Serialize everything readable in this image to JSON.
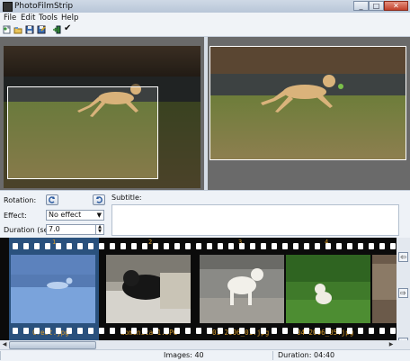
{
  "window": {
    "title": "PhotoFilmStrip",
    "minimize": "_",
    "maximize": "□",
    "close": "✕"
  },
  "menu": [
    "File",
    "Edit",
    "Tools",
    "Help"
  ],
  "toolbar": {
    "icons": [
      "new-project-icon",
      "open-project-icon",
      "save-icon",
      "save-as-icon",
      "import-pictures-icon",
      "render-checkmark-icon"
    ],
    "render_glyph": "✔"
  },
  "properties": {
    "rotation_label": "Rotation:",
    "effect_label": "Effect:",
    "effect_value": "No effect",
    "duration_label": "Duration (sec):",
    "duration_value": "7.0",
    "subtitle_label": "Subtitle:",
    "subtitle_value": ""
  },
  "filmstrip": {
    "frames": [
      {
        "number": "1",
        "name": "Crest.jpg",
        "selected": true
      },
      {
        "number": "2",
        "name": "domenica-1.JPG",
        "selected": false
      },
      {
        "number": "3",
        "name": "01-2006_01.jpg",
        "selected": false
      },
      {
        "number": "4",
        "name": "04-2006_05.jpg",
        "selected": false
      }
    ],
    "nav_left": "⇦",
    "nav_right": "⇨",
    "clear_glyph": "✕"
  },
  "scrollbar": {
    "left": "◀",
    "right": "▶"
  },
  "status": {
    "images": "Images: 40",
    "duration": "Duration: 04:40"
  },
  "colors": {
    "film": "#0b0b0b",
    "frame_text": "#d59a2c",
    "selection": "#468cdc"
  }
}
